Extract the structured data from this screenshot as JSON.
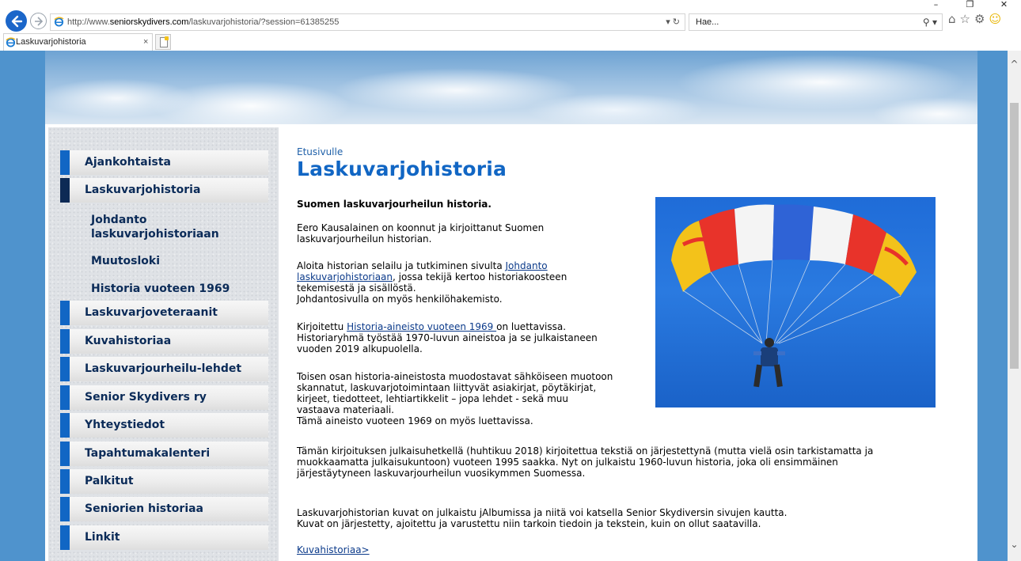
{
  "browser": {
    "url_prefix": "http://www.",
    "url_domain": "seniorskydivers.com",
    "url_path": "/laskuvarjohistoria/?session=61385255",
    "search_placeholder": "Hae...",
    "tab_label": "Laskuvarjohistoria",
    "tab_close": "×"
  },
  "sidebar": {
    "items": [
      {
        "label": "Ajankohtaista"
      },
      {
        "label": "Laskuvarjohistoria"
      },
      {
        "label": "Laskuvarjoveteraanit"
      },
      {
        "label": "Kuvahistoriaa"
      },
      {
        "label": "Laskuvarjourheilu-lehdet"
      },
      {
        "label": "Senior Skydivers ry"
      },
      {
        "label": "Yhteystiedot"
      },
      {
        "label": "Tapahtumakalenteri"
      },
      {
        "label": "Palkitut"
      },
      {
        "label": "Seniorien historiaa"
      },
      {
        "label": "Linkit"
      }
    ],
    "subitems": [
      {
        "line1": "Johdanto",
        "line2": "laskuvarjohistoriaan"
      },
      {
        "line1": "Muutosloki"
      },
      {
        "line1": "Historia vuoteen 1969"
      }
    ]
  },
  "main": {
    "breadcrumb": "Etusivulle",
    "title": "Laskuvarjohistoria",
    "heading": "Suomen laskuvarjourheilun historia.",
    "p1_l1": "Eero Kausalainen on koonnut ja kirjoittanut Suomen",
    "p1_l2": "laskuvarjourheilun historian.",
    "p2_l1_pre": "Aloita historian selailu ja tutkiminen sivulta ",
    "p2_link_a": "Johdanto",
    "p2_link_b": "laskuvarjohistoriaan",
    "p2_l2_post": ", jossa tekijä kertoo historiakoosteen",
    "p2_l3": "tekemisestä ja sisällöstä.",
    "p2_l4": "Johdantosivulla on myös henkilöhakemisto.",
    "p3_pre": "Kirjoitettu ",
    "p3_link": "Historia-aineisto vuoteen 1969 ",
    "p3_post": "on luettavissa.",
    "p3_l2": "Historiaryhmä työstää 1970-luvun aineistoa ja se julkaistaneen",
    "p3_l3": "vuoden 2019 alkupuolella.",
    "p4_l1": "Toisen osan historia-aineistosta muodostavat sähköiseen muotoon",
    "p4_l2": "skannatut, laskuvarjotoimintaan liittyvät asiakirjat, pöytäkirjat,",
    "p4_l3": "kirjeet, tiedotteet, lehtiartikkelit – jopa lehdet - sekä muu",
    "p4_l4": "vastaava materiaali.",
    "p4_l5": "Tämä aineisto vuoteen 1969 on myös luettavissa.",
    "p5_l1": "Tämän kirjoituksen julkaisuhetkellä (huhtikuu 2018) kirjoitettua tekstiä on järjestettynä (mutta vielä osin tarkistamatta ja",
    "p5_l2": "muokkaamatta julkaisukuntoon) vuoteen 1995 saakka. Nyt on julkaistu 1960-luvun historia, joka oli ensimmäinen",
    "p5_l3": "järjestäytyneen laskuvarjourheilun vuosikymmen Suomessa.",
    "p6_l1": "Laskuvarjohistorian kuvat on julkaistu jAlbumissa ja niitä voi katsella Senior Skydiversin sivujen kautta.",
    "p6_l2": "Kuvat on järjestetty, ajoitettu ja varustettu niin tarkoin tiedoin ja tekstein, kuin on ollut saatavilla.",
    "bottom_link": "Kuvahistoriaa>"
  }
}
